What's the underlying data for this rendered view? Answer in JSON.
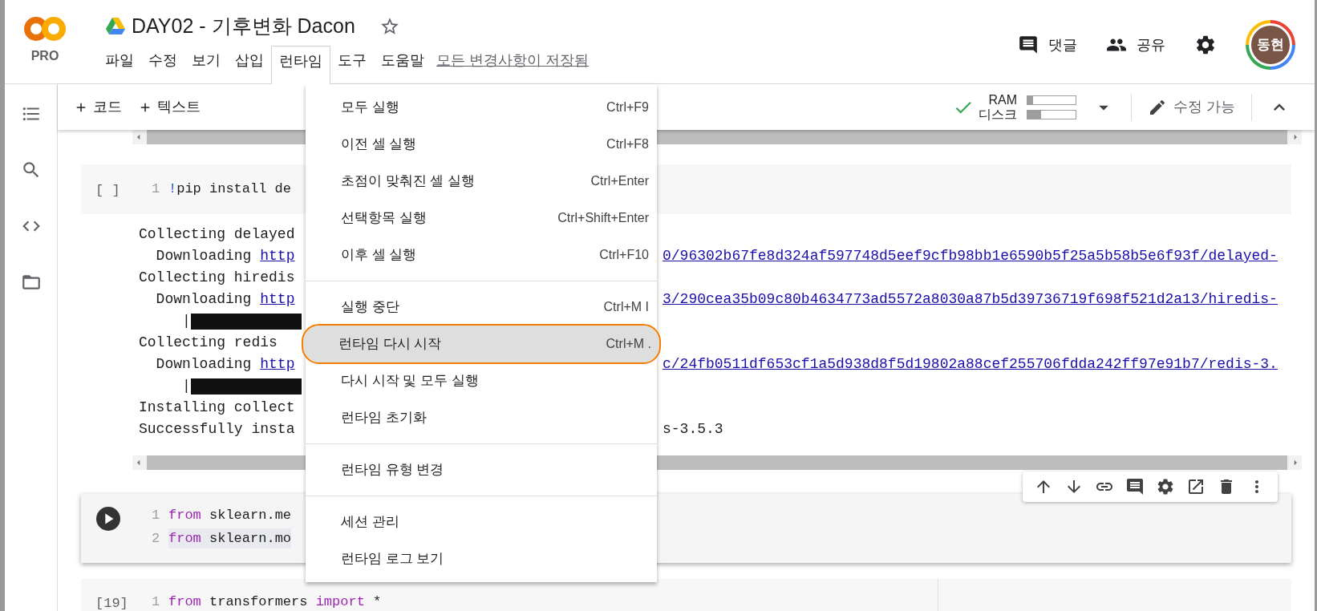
{
  "app": {
    "plan": "PRO"
  },
  "title": "DAY02 - 기후변화 Dacon",
  "starred": false,
  "menubar": [
    {
      "label": "파일",
      "selected": false
    },
    {
      "label": "수정",
      "selected": false
    },
    {
      "label": "보기",
      "selected": false
    },
    {
      "label": "삽입",
      "selected": false
    },
    {
      "label": "런타임",
      "selected": true
    },
    {
      "label": "도구",
      "selected": false
    },
    {
      "label": "도움말",
      "selected": false
    }
  ],
  "save_status": "모든 변경사항이 저장됨",
  "header_actions": [
    {
      "kind": "comment",
      "label": "댓글"
    },
    {
      "kind": "share",
      "label": "공유"
    }
  ],
  "avatar": "동현",
  "sidebar": [
    {
      "kind": "toc"
    },
    {
      "kind": "search"
    },
    {
      "kind": "code"
    },
    {
      "kind": "files"
    }
  ],
  "toolbar": {
    "add_buttons": [
      "코드",
      "텍스트"
    ],
    "connected": true,
    "resources": [
      {
        "label": "RAM",
        "level": 0.12
      },
      {
        "label": "디스크",
        "level": 0.28
      }
    ],
    "edit_mode": "수정 가능"
  },
  "cells": [
    {
      "prompt": "[ ]",
      "selected": false,
      "lines": [
        {
          "number": "1",
          "highlighted": false,
          "tokens": [
            {
              "kind": "magic",
              "text": "!"
            },
            {
              "kind": "plain",
              "text": "pip install de"
            }
          ]
        }
      ],
      "output": [
        {
          "left": [
            {
              "kind": "text",
              "text": "Collecting delayed"
            }
          ]
        },
        {
          "left": [
            {
              "kind": "text",
              "text": "  Downloading "
            },
            {
              "kind": "link",
              "text": "http"
            }
          ],
          "right": "0/96302b67fe8d324af597748d5eef9cfb98bb1e6590b5f25a5b58b5e6f93f/delayed-"
        },
        {
          "left": [
            {
              "kind": "text",
              "text": "Collecting hiredis"
            }
          ]
        },
        {
          "left": [
            {
              "kind": "text",
              "text": "  Downloading "
            },
            {
              "kind": "link",
              "text": "http"
            }
          ],
          "right": "3/290cea35b09c80b4634773ad5572a8030a87b5d39736719f698f521d2a13/hiredis-"
        },
        {
          "left": [
            {
              "kind": "text",
              "text": "     |"
            },
            {
              "kind": "blocks"
            }
          ]
        },
        {
          "left": [
            {
              "kind": "text",
              "text": "Collecting redis"
            }
          ]
        },
        {
          "left": [
            {
              "kind": "text",
              "text": "  Downloading "
            },
            {
              "kind": "link",
              "text": "http"
            }
          ],
          "right": "c/24fb0511df653cf1a5d938d8f5d19802a88cef255706fdda242ff97e91b7/redis-3."
        },
        {
          "left": [
            {
              "kind": "text",
              "text": "     |"
            },
            {
              "kind": "blocks"
            }
          ]
        },
        {
          "left": [
            {
              "kind": "text",
              "text": "Installing collect"
            }
          ]
        },
        {
          "left": [
            {
              "kind": "text",
              "text": "Successfully insta"
            }
          ],
          "right_plain": "s-3.5.3"
        }
      ]
    },
    {
      "selected": true,
      "lines": [
        {
          "number": "1",
          "highlighted": false,
          "tokens": [
            {
              "kind": "keyword",
              "text": "from"
            },
            {
              "kind": "plain",
              "text": " sklearn.me"
            }
          ]
        },
        {
          "number": "2",
          "highlighted": true,
          "tokens": [
            {
              "kind": "keyword",
              "text": "from"
            },
            {
              "kind": "plain",
              "text": " sklearn.mo"
            }
          ]
        }
      ],
      "cell_toolbar": [
        {
          "kind": "up"
        },
        {
          "kind": "down"
        },
        {
          "kind": "link"
        },
        {
          "kind": "comment"
        },
        {
          "kind": "settings"
        },
        {
          "kind": "mirror"
        },
        {
          "kind": "delete"
        },
        {
          "kind": "more"
        }
      ]
    },
    {
      "prompt": "[19]",
      "selected": false,
      "lines": [
        {
          "number": "1",
          "highlighted": false,
          "tokens": [
            {
              "kind": "keyword",
              "text": "from"
            },
            {
              "kind": "plain",
              "text": " transformers "
            },
            {
              "kind": "keyword",
              "text": "import"
            },
            {
              "kind": "plain",
              "text": " *"
            }
          ]
        }
      ]
    }
  ],
  "runtime_menu": [
    {
      "kind": "item",
      "label": "모두 실행",
      "shortcut": "Ctrl+F9",
      "selected": false
    },
    {
      "kind": "item",
      "label": "이전 셀 실행",
      "shortcut": "Ctrl+F8",
      "selected": false
    },
    {
      "kind": "item",
      "label": "초점이 맞춰진 셀 실행",
      "shortcut": "Ctrl+Enter",
      "selected": false
    },
    {
      "kind": "item",
      "label": "선택항목 실행",
      "shortcut": "Ctrl+Shift+Enter",
      "selected": false
    },
    {
      "kind": "item",
      "label": "이후 셀 실행",
      "shortcut": "Ctrl+F10",
      "selected": false
    },
    {
      "kind": "divider"
    },
    {
      "kind": "item",
      "label": "실행 중단",
      "shortcut": "Ctrl+M I",
      "selected": false
    },
    {
      "kind": "item",
      "label": "런타임 다시 시작",
      "shortcut": "Ctrl+M .",
      "selected": true
    },
    {
      "kind": "item",
      "label": "다시 시작 및 모두 실행",
      "selected": false
    },
    {
      "kind": "item",
      "label": "런타임 초기화",
      "selected": false
    },
    {
      "kind": "divider"
    },
    {
      "kind": "item",
      "label": "런타임 유형 변경",
      "selected": false
    },
    {
      "kind": "divider"
    },
    {
      "kind": "item",
      "label": "세션 관리",
      "selected": false
    },
    {
      "kind": "item",
      "label": "런타임 로그 보기",
      "selected": false
    }
  ]
}
